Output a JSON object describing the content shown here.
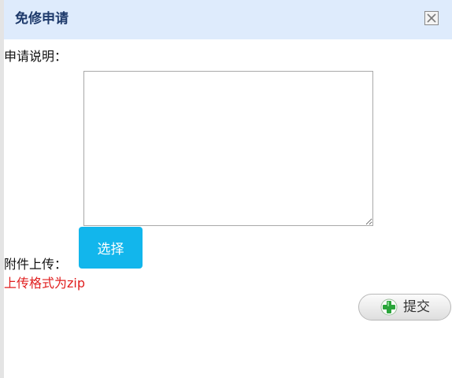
{
  "dialog": {
    "title": "免修申请",
    "description_label": "申请说明：",
    "description_value": "",
    "attachment_label": "附件上传：",
    "choose_button_label": "选择",
    "format_hint": "上传格式为zip",
    "submit_button_label": "提交"
  },
  "icons": {
    "close": "close-icon",
    "submit": "green-plus-icon"
  },
  "colors": {
    "titlebar_bg": "#deebfc",
    "title_text": "#1e3a6b",
    "choose_button_bg": "#12b6ec",
    "hint_text": "#e01e1e",
    "plus_icon": "#2aa53a"
  }
}
